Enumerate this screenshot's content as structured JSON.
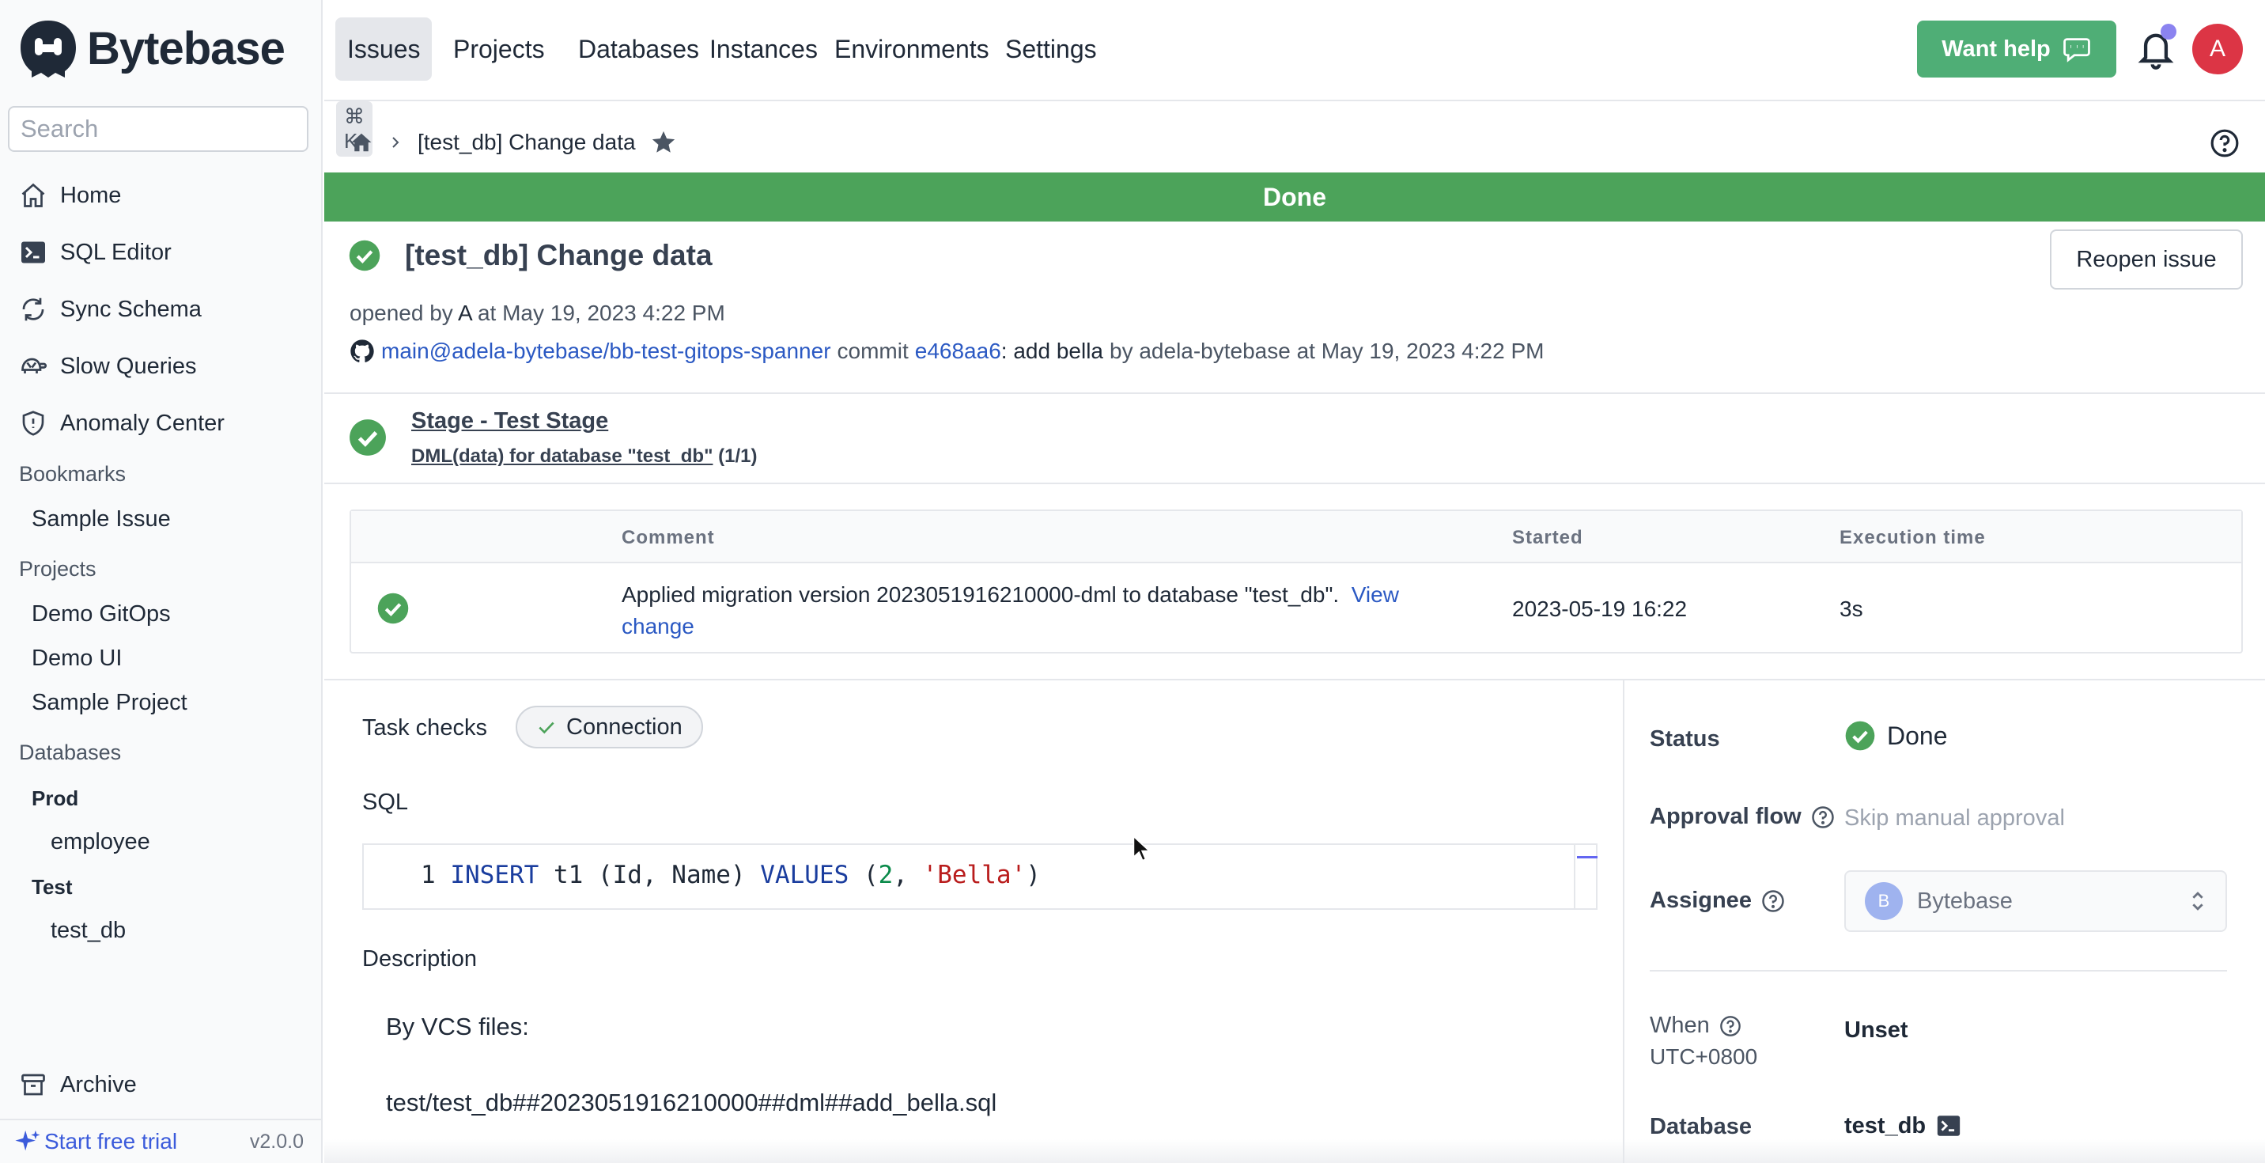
{
  "app": {
    "name": "Bytebase",
    "version": "v2.0.0",
    "trial_label": "Start free trial"
  },
  "search": {
    "placeholder": "Search",
    "shortcut": "⌘ K"
  },
  "sidebar": {
    "nav": [
      {
        "label": "Home",
        "icon": "home-icon"
      },
      {
        "label": "SQL Editor",
        "icon": "terminal-icon"
      },
      {
        "label": "Sync Schema",
        "icon": "sync-icon"
      },
      {
        "label": "Slow Queries",
        "icon": "turtle-icon"
      },
      {
        "label": "Anomaly Center",
        "icon": "shield-icon"
      }
    ],
    "bookmarks_label": "Bookmarks",
    "bookmarks": [
      "Sample Issue"
    ],
    "projects_label": "Projects",
    "projects": [
      "Demo GitOps",
      "Demo UI",
      "Sample Project"
    ],
    "databases_label": "Databases",
    "environments": [
      {
        "name": "Prod",
        "databases": [
          "employee"
        ]
      },
      {
        "name": "Test",
        "databases": [
          "test_db"
        ]
      }
    ],
    "archive_label": "Archive"
  },
  "topnav": {
    "tabs": [
      "Issues",
      "Projects",
      "Databases",
      "Instances",
      "Environments",
      "Settings"
    ],
    "active_tab": "Issues",
    "help_label": "Want help",
    "avatar_initial": "A"
  },
  "breadcrumb": {
    "current": "[test_db] Change data"
  },
  "banner": {
    "text": "Done",
    "color": "#4ca35a"
  },
  "issue": {
    "title": "[test_db] Change data",
    "reopen_label": "Reopen issue",
    "opened_prefix": "opened by",
    "opened_by": "A",
    "opened_at": "at May 19, 2023 4:22 PM",
    "repo": "main@adela-bytebase/bb-test-gitops-spanner",
    "commit_word": "commit",
    "commit_hash": "e468aa6",
    "commit_message": ": add bella",
    "commit_by": "by adela-bytebase at May 19, 2023 4:22 PM"
  },
  "stage": {
    "title": "Stage - Test Stage",
    "task_link": "DML(data) for database \"test_db\"",
    "task_count": "(1/1)"
  },
  "task_table": {
    "headers": {
      "comment": "Comment",
      "started": "Started",
      "execution": "Execution time"
    },
    "row": {
      "comment": "Applied migration version 2023051916210000-dml to database \"test_db\".",
      "link_part1": "View",
      "link_part2": "change",
      "started": "2023-05-19 16:22",
      "execution": "3s"
    }
  },
  "checks": {
    "label": "Task checks",
    "pill": "Connection"
  },
  "sql": {
    "label": "SQL",
    "line_number": "1",
    "tokens": {
      "kw1": "INSERT",
      "t1": " t1 (Id, Name) ",
      "kw2": "VALUES",
      "t2": " (",
      "num": "2",
      "t3": ", ",
      "str": "'Bella'",
      "t4": ")"
    }
  },
  "description": {
    "label": "Description",
    "line1": "By VCS files:",
    "line2": "test/test_db##2023051916210000##dml##add_bella.sql"
  },
  "side": {
    "status_label": "Status",
    "status_value": "Done",
    "approval_label": "Approval flow",
    "approval_value": "Skip manual approval",
    "assignee_label": "Assignee",
    "assignee_value": "Bytebase",
    "assignee_initial": "B",
    "when_label": "When",
    "when_tz": "UTC+0800",
    "when_value": "Unset",
    "database_label": "Database",
    "database_value": "test_db"
  },
  "colors": {
    "accent": "#4fae76",
    "success": "#4ca35a",
    "link": "#2b59c3",
    "danger": "#dc3545"
  }
}
